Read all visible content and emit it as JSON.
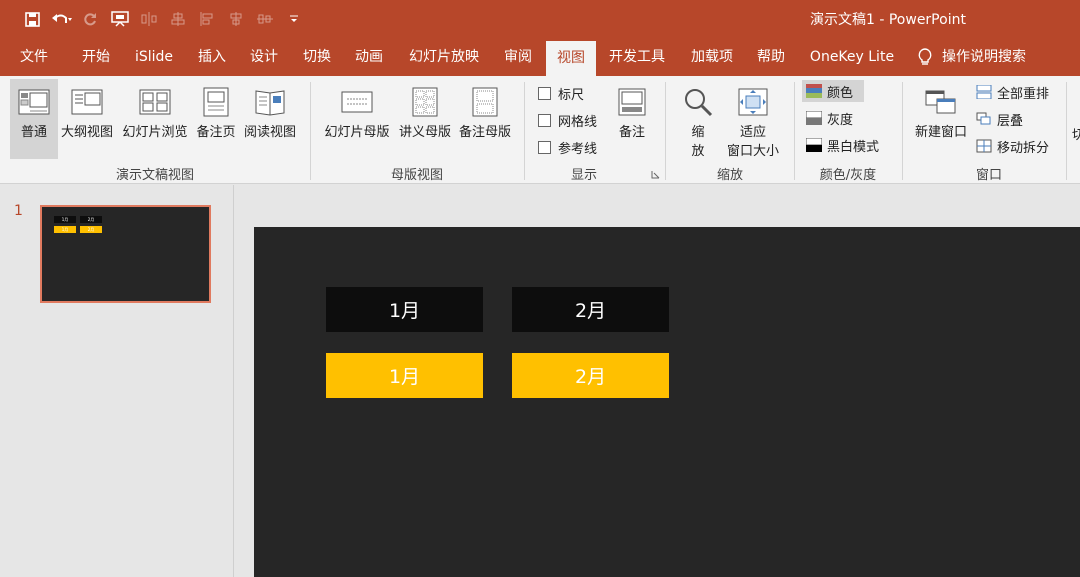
{
  "window": {
    "title": "演示文稿1  -  PowerPoint"
  },
  "quick_access": [
    {
      "icon": "save-icon"
    },
    {
      "icon": "undo-icon"
    },
    {
      "icon": "redo-icon"
    },
    {
      "icon": "present-icon"
    },
    {
      "icon": "align-icon"
    },
    {
      "icon": "align-icon"
    },
    {
      "icon": "align-icon"
    },
    {
      "icon": "align-icon"
    },
    {
      "icon": "align-icon"
    },
    {
      "icon": "customize-icon"
    }
  ],
  "tabs": [
    "文件",
    "开始",
    "iSlide",
    "插入",
    "设计",
    "切换",
    "动画",
    "幻灯片放映",
    "审阅",
    "视图",
    "开发工具",
    "加载项",
    "帮助",
    "OneKey Lite",
    "操作说明搜索"
  ],
  "active_tab": "视图",
  "ribbon": {
    "presentation_views": {
      "label": "演示文稿视图",
      "buttons": [
        "普通",
        "大纲视图",
        "幻灯片浏览",
        "备注页",
        "阅读视图"
      ]
    },
    "master_views": {
      "label": "母版视图",
      "buttons": [
        "幻灯片母版",
        "讲义母版",
        "备注母版"
      ]
    },
    "show": {
      "label": "显示",
      "checkboxes": [
        "标尺",
        "网格线",
        "参考线"
      ],
      "notes_button": "备注"
    },
    "zoom": {
      "label": "缩放",
      "zoom_button": "缩\n放",
      "zoom_line1": "缩",
      "zoom_line2": "放",
      "fit_line1": "适应",
      "fit_line2": "窗口大小"
    },
    "color_gray": {
      "label": "颜色/灰度",
      "options": [
        "颜色",
        "灰度",
        "黑白模式"
      ]
    },
    "window": {
      "label": "窗口",
      "new_window": "新建窗口",
      "items": [
        "全部重排",
        "层叠",
        "移动拆分"
      ],
      "cut_text": "切"
    }
  },
  "slides_panel": {
    "slide_number": "1"
  },
  "slide": {
    "boxes": [
      {
        "text": "1月",
        "style": "black"
      },
      {
        "text": "2月",
        "style": "black"
      },
      {
        "text": "1月",
        "style": "yellow"
      },
      {
        "text": "2月",
        "style": "yellow"
      }
    ]
  },
  "colors": {
    "accent": "#b7472a",
    "slide_bg": "#262626",
    "box_black": "#0d0d0d",
    "box_yellow": "#ffc000"
  }
}
